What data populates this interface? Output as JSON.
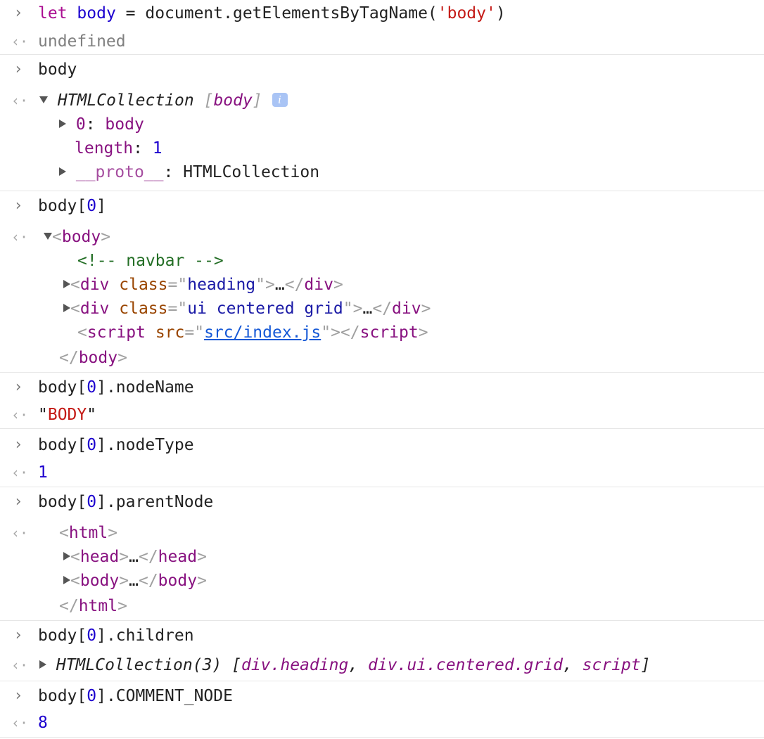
{
  "glyphs": {
    "prompt": "›",
    "result": "‹·"
  },
  "e1": {
    "input": {
      "kw": "let",
      "var": "body",
      "eq": " = ",
      "call": "document.getElementsByTagName(",
      "str": "'body'",
      "close": ")"
    },
    "output": "undefined"
  },
  "e2": {
    "input": "body",
    "output": {
      "type": "HTMLCollection",
      "tag": "[body]",
      "info": "i",
      "items": [
        {
          "key": "0",
          "sep": ": ",
          "value": "body"
        },
        {
          "key": "length",
          "sep": ": ",
          "value": "1"
        },
        {
          "key": "__proto__",
          "sep": ": ",
          "value": "HTMLCollection"
        }
      ]
    }
  },
  "e3": {
    "input": {
      "base": "body[",
      "idx": "0",
      "end": "]"
    },
    "dom": {
      "body_open": "body",
      "comment": "<!-- navbar -->",
      "div1": {
        "tag": "div",
        "attr": "class",
        "value": "heading",
        "ellipsis": "…"
      },
      "div2": {
        "tag": "div",
        "attr": "class",
        "value": "ui centered grid",
        "ellipsis": "…"
      },
      "script": {
        "tag": "script",
        "attr": "src",
        "value": "src/index.js"
      },
      "body_close": "body"
    }
  },
  "e4": {
    "input": {
      "base": "body[",
      "idx": "0",
      "end": "].nodeName"
    },
    "output": "\"BODY\"",
    "output_q": "\"",
    "output_s": "BODY"
  },
  "e5": {
    "input": {
      "base": "body[",
      "idx": "0",
      "end": "].nodeType"
    },
    "output": "1"
  },
  "e6": {
    "input": {
      "base": "body[",
      "idx": "0",
      "end": "].parentNode"
    },
    "dom": {
      "html_open": "html",
      "head": "head",
      "body": "body",
      "ellipsis": "…",
      "html_close": "html"
    }
  },
  "e7": {
    "input": {
      "base": "body[",
      "idx": "0",
      "end": "].children"
    },
    "output": {
      "type": "HTMLCollection(3)",
      "open": " [",
      "items": [
        "div.heading",
        "div.ui.centered.grid",
        "script"
      ],
      "sep": ", ",
      "close": "]"
    }
  },
  "e8": {
    "input": {
      "base": "body[",
      "idx": "0",
      "end": "].COMMENT_NODE"
    },
    "output": "8"
  }
}
